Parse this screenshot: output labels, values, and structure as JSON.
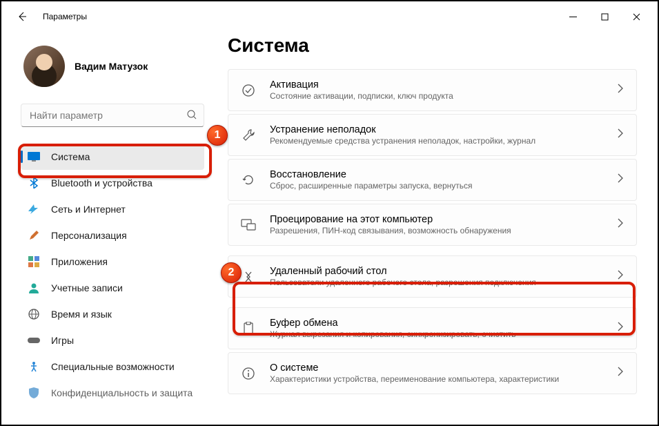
{
  "window": {
    "title": "Параметры"
  },
  "profile": {
    "name": "Вадим Матузок"
  },
  "search": {
    "placeholder": "Найти параметр"
  },
  "sidebar": {
    "items": [
      {
        "label": "Система",
        "icon": "🖥️",
        "selected": true
      },
      {
        "label": "Bluetooth и устройства",
        "icon": "bt"
      },
      {
        "label": "Сеть и Интернет",
        "icon": "🔷"
      },
      {
        "label": "Персонализация",
        "icon": "🖌️"
      },
      {
        "label": "Приложения",
        "icon": "apps"
      },
      {
        "label": "Учетные записи",
        "icon": "👤"
      },
      {
        "label": "Время и язык",
        "icon": "🌐"
      },
      {
        "label": "Игры",
        "icon": "🎮"
      },
      {
        "label": "Специальные возможности",
        "icon": "acc"
      },
      {
        "label": "Конфиденциальность и защита",
        "icon": "🛡️"
      }
    ]
  },
  "page": {
    "title": "Система",
    "rows": [
      {
        "title": "Активация",
        "sub": "Состояние активации, подписки, ключ продукта"
      },
      {
        "title": "Устранение неполадок",
        "sub": "Рекомендуемые средства устранения неполадок, настройки, журнал"
      },
      {
        "title": "Восстановление",
        "sub": "Сброс, расширенные параметры запуска, вернуться"
      },
      {
        "title": "Проецирование на этот компьютер",
        "sub": "Разрешения, ПИН-код связывания, возможность обнаружения"
      },
      {
        "title": "Удаленный рабочий стол",
        "sub": "Пользователи удаленного рабочего стола, разрешения подключения"
      },
      {
        "title": "Буфер обмена",
        "sub": "Журнал вырезания и копирования, синхронизировать, очистить"
      },
      {
        "title": "О системе",
        "sub": "Характеристики устройства, переименование компьютера, характеристики"
      }
    ]
  },
  "annotations": {
    "badge1": "1",
    "badge2": "2"
  }
}
